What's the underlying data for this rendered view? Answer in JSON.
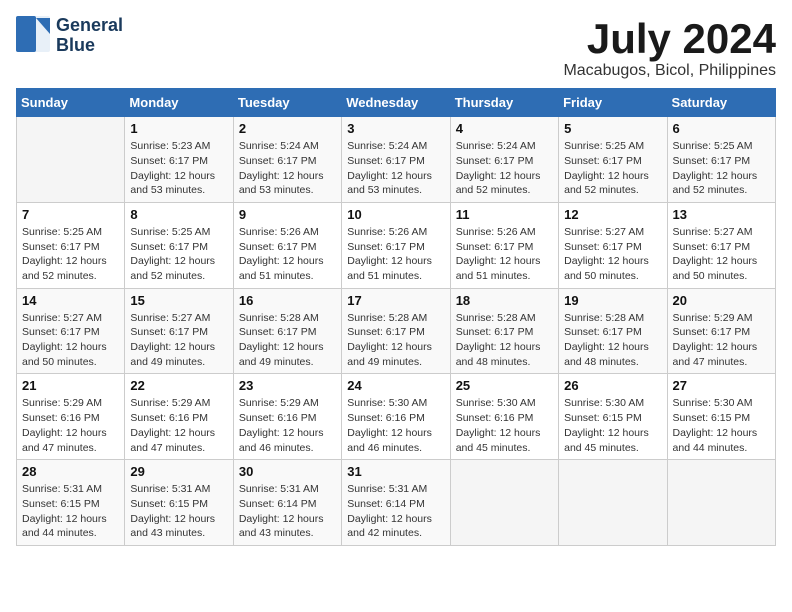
{
  "logo": {
    "line1": "General",
    "line2": "Blue"
  },
  "title": "July 2024",
  "location": "Macabugos, Bicol, Philippines",
  "days_of_week": [
    "Sunday",
    "Monday",
    "Tuesday",
    "Wednesday",
    "Thursday",
    "Friday",
    "Saturday"
  ],
  "weeks": [
    [
      {
        "day": "",
        "info": ""
      },
      {
        "day": "1",
        "info": "Sunrise: 5:23 AM\nSunset: 6:17 PM\nDaylight: 12 hours\nand 53 minutes."
      },
      {
        "day": "2",
        "info": "Sunrise: 5:24 AM\nSunset: 6:17 PM\nDaylight: 12 hours\nand 53 minutes."
      },
      {
        "day": "3",
        "info": "Sunrise: 5:24 AM\nSunset: 6:17 PM\nDaylight: 12 hours\nand 53 minutes."
      },
      {
        "day": "4",
        "info": "Sunrise: 5:24 AM\nSunset: 6:17 PM\nDaylight: 12 hours\nand 52 minutes."
      },
      {
        "day": "5",
        "info": "Sunrise: 5:25 AM\nSunset: 6:17 PM\nDaylight: 12 hours\nand 52 minutes."
      },
      {
        "day": "6",
        "info": "Sunrise: 5:25 AM\nSunset: 6:17 PM\nDaylight: 12 hours\nand 52 minutes."
      }
    ],
    [
      {
        "day": "7",
        "info": "Sunrise: 5:25 AM\nSunset: 6:17 PM\nDaylight: 12 hours\nand 52 minutes."
      },
      {
        "day": "8",
        "info": "Sunrise: 5:25 AM\nSunset: 6:17 PM\nDaylight: 12 hours\nand 52 minutes."
      },
      {
        "day": "9",
        "info": "Sunrise: 5:26 AM\nSunset: 6:17 PM\nDaylight: 12 hours\nand 51 minutes."
      },
      {
        "day": "10",
        "info": "Sunrise: 5:26 AM\nSunset: 6:17 PM\nDaylight: 12 hours\nand 51 minutes."
      },
      {
        "day": "11",
        "info": "Sunrise: 5:26 AM\nSunset: 6:17 PM\nDaylight: 12 hours\nand 51 minutes."
      },
      {
        "day": "12",
        "info": "Sunrise: 5:27 AM\nSunset: 6:17 PM\nDaylight: 12 hours\nand 50 minutes."
      },
      {
        "day": "13",
        "info": "Sunrise: 5:27 AM\nSunset: 6:17 PM\nDaylight: 12 hours\nand 50 minutes."
      }
    ],
    [
      {
        "day": "14",
        "info": "Sunrise: 5:27 AM\nSunset: 6:17 PM\nDaylight: 12 hours\nand 50 minutes."
      },
      {
        "day": "15",
        "info": "Sunrise: 5:27 AM\nSunset: 6:17 PM\nDaylight: 12 hours\nand 49 minutes."
      },
      {
        "day": "16",
        "info": "Sunrise: 5:28 AM\nSunset: 6:17 PM\nDaylight: 12 hours\nand 49 minutes."
      },
      {
        "day": "17",
        "info": "Sunrise: 5:28 AM\nSunset: 6:17 PM\nDaylight: 12 hours\nand 49 minutes."
      },
      {
        "day": "18",
        "info": "Sunrise: 5:28 AM\nSunset: 6:17 PM\nDaylight: 12 hours\nand 48 minutes."
      },
      {
        "day": "19",
        "info": "Sunrise: 5:28 AM\nSunset: 6:17 PM\nDaylight: 12 hours\nand 48 minutes."
      },
      {
        "day": "20",
        "info": "Sunrise: 5:29 AM\nSunset: 6:17 PM\nDaylight: 12 hours\nand 47 minutes."
      }
    ],
    [
      {
        "day": "21",
        "info": "Sunrise: 5:29 AM\nSunset: 6:16 PM\nDaylight: 12 hours\nand 47 minutes."
      },
      {
        "day": "22",
        "info": "Sunrise: 5:29 AM\nSunset: 6:16 PM\nDaylight: 12 hours\nand 47 minutes."
      },
      {
        "day": "23",
        "info": "Sunrise: 5:29 AM\nSunset: 6:16 PM\nDaylight: 12 hours\nand 46 minutes."
      },
      {
        "day": "24",
        "info": "Sunrise: 5:30 AM\nSunset: 6:16 PM\nDaylight: 12 hours\nand 46 minutes."
      },
      {
        "day": "25",
        "info": "Sunrise: 5:30 AM\nSunset: 6:16 PM\nDaylight: 12 hours\nand 45 minutes."
      },
      {
        "day": "26",
        "info": "Sunrise: 5:30 AM\nSunset: 6:15 PM\nDaylight: 12 hours\nand 45 minutes."
      },
      {
        "day": "27",
        "info": "Sunrise: 5:30 AM\nSunset: 6:15 PM\nDaylight: 12 hours\nand 44 minutes."
      }
    ],
    [
      {
        "day": "28",
        "info": "Sunrise: 5:31 AM\nSunset: 6:15 PM\nDaylight: 12 hours\nand 44 minutes."
      },
      {
        "day": "29",
        "info": "Sunrise: 5:31 AM\nSunset: 6:15 PM\nDaylight: 12 hours\nand 43 minutes."
      },
      {
        "day": "30",
        "info": "Sunrise: 5:31 AM\nSunset: 6:14 PM\nDaylight: 12 hours\nand 43 minutes."
      },
      {
        "day": "31",
        "info": "Sunrise: 5:31 AM\nSunset: 6:14 PM\nDaylight: 12 hours\nand 42 minutes."
      },
      {
        "day": "",
        "info": ""
      },
      {
        "day": "",
        "info": ""
      },
      {
        "day": "",
        "info": ""
      }
    ]
  ]
}
